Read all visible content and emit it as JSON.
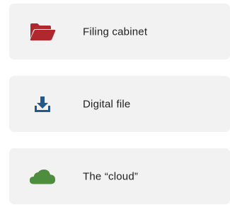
{
  "options": [
    {
      "label": "Filing cabinet",
      "icon": "folder-open-icon",
      "icon_color": "#b0282e"
    },
    {
      "label": "Digital file",
      "icon": "download-icon",
      "icon_color": "#21598c"
    },
    {
      "label": "The “cloud”",
      "icon": "cloud-icon",
      "icon_color": "#4e8c3e"
    }
  ]
}
